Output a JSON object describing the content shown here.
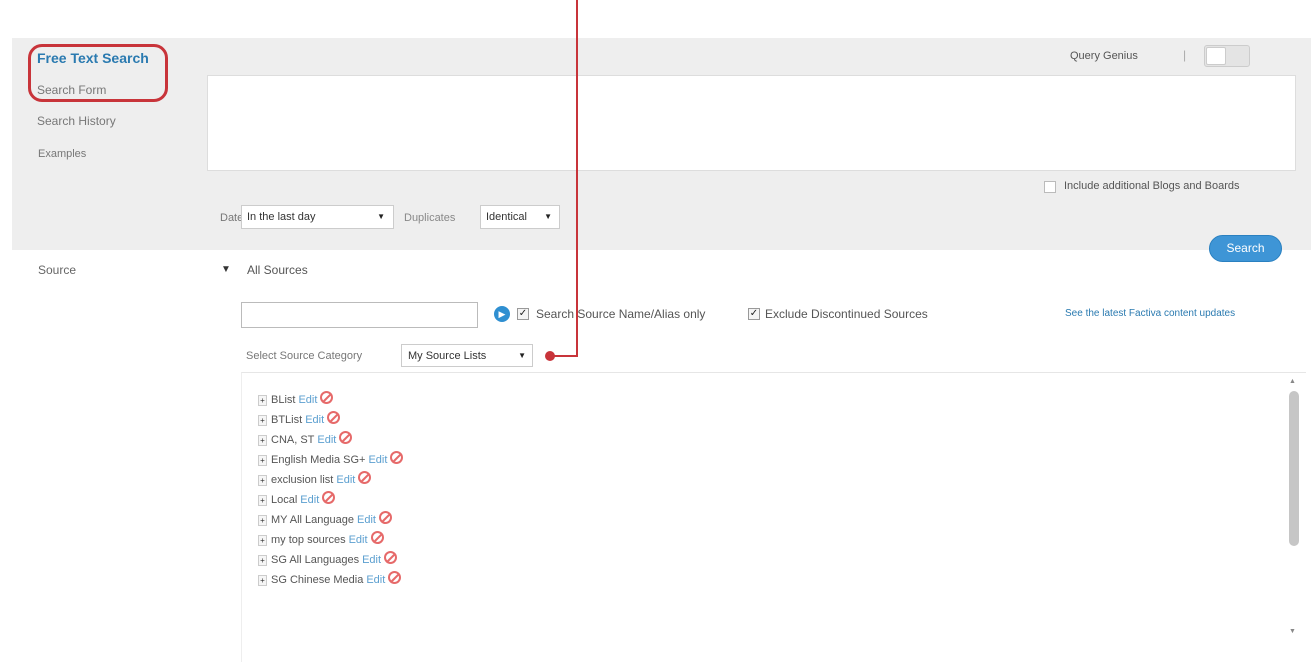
{
  "nav": {
    "free_text_search": "Free Text Search",
    "search_form": "Search Form",
    "search_history": "Search History",
    "examples": "Examples"
  },
  "query_genius": {
    "label": "Query Genius",
    "separator": "|"
  },
  "query": {
    "value": ""
  },
  "options": {
    "blogs_label": "Include additional Blogs and Boards",
    "date_label": "Date",
    "date_value": "In the last day",
    "duplicates_label": "Duplicates",
    "duplicates_value": "Identical",
    "search_label": "Search"
  },
  "source": {
    "label": "Source",
    "all_sources": "All Sources",
    "search_input_value": "",
    "name_only_label": "Search Source Name/Alias only",
    "exclude_label": "Exclude Discontinued Sources",
    "content_updates_link": "See the latest Factiva content updates",
    "category_label": "Select Source Category",
    "category_value": "My Source Lists",
    "edit_label": "Edit",
    "lists": [
      "BList",
      "BTList",
      "CNA, ST",
      "English Media SG+",
      "exclusion list",
      "Local",
      "MY All Language",
      "my top sources",
      "SG All Languages",
      "SG Chinese Media"
    ]
  },
  "colors": {
    "accent_blue": "#2a7ab0",
    "button_blue": "#3e95d6",
    "annotation_red": "#c8343a",
    "panel_gray": "#eeeeee"
  }
}
